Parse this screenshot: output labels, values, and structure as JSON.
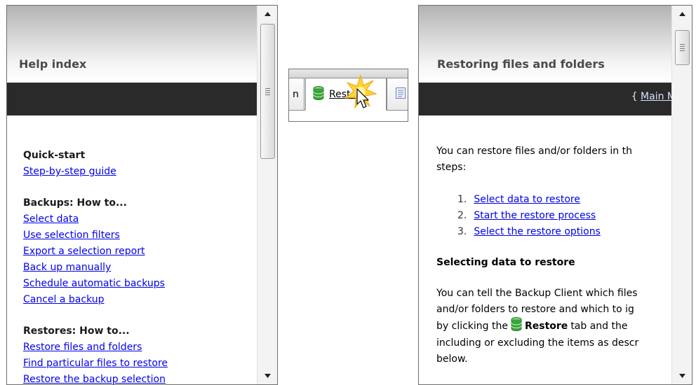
{
  "left_panel": {
    "title": "Help index",
    "sections": [
      {
        "heading": "Quick-start",
        "links": [
          "Step-by-step guide"
        ]
      },
      {
        "heading": "Backups: How to...",
        "links": [
          "Select data",
          "Use selection filters",
          "Export a selection report",
          "Back up manually",
          "Schedule automatic backups",
          "Cancel a backup"
        ]
      },
      {
        "heading": "Restores: How to...",
        "links": [
          "Restore files and folders",
          "Find particular files to restore",
          "Restore the backup selection"
        ]
      }
    ]
  },
  "tab_strip": {
    "prev_tab_label": "n",
    "restore_tab_label": "Restore",
    "restore_icon": "database-icon",
    "next_tab_icon": "document-icon",
    "cursor_icon": "arrow-cursor-click-icon"
  },
  "right_panel": {
    "title": "Restoring files and folders",
    "band_link_prefix": "{ ",
    "band_link": "Main M",
    "intro": [
      "You can restore files and/or folders in th",
      "steps:"
    ],
    "steps": [
      {
        "num": "1.",
        "label": "Select data to restore"
      },
      {
        "num": "2.",
        "label": "Start the restore process"
      },
      {
        "num": "3.",
        "label": "Select the restore options"
      }
    ],
    "subheading": "Selecting data to restore",
    "para_lines": [
      "You can tell the Backup Client which files",
      "and/or folders to restore and which to ig"
    ],
    "para_line3_start": "by clicking the",
    "para_line3_bold": "Restore",
    "para_line3_end": "tab and the",
    "para_rest": [
      "including or excluding the items as descr",
      "below."
    ]
  },
  "colors": {
    "link": "#0000ee",
    "header_band": "#2a2a2a",
    "title": "#4a4a4a",
    "db_green": "#3aa43a"
  }
}
